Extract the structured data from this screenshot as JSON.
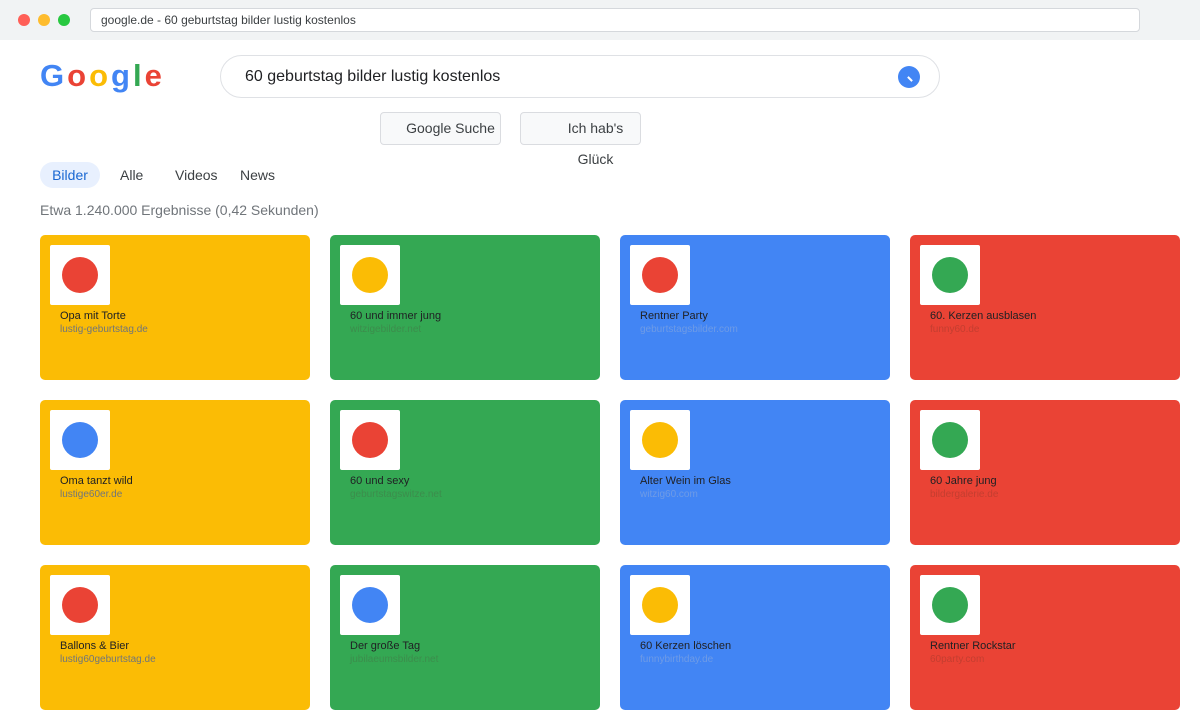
{
  "browser": {
    "address": "google.de - 60 geburtstag bilder lustig kostenlos"
  },
  "logo": {
    "letters": [
      {
        "ch": "G",
        "color": "#4285f4"
      },
      {
        "ch": "o",
        "color": "#ea4335"
      },
      {
        "ch": "o",
        "color": "#fbbc05"
      },
      {
        "ch": "g",
        "color": "#4285f4"
      },
      {
        "ch": "l",
        "color": "#34a853"
      },
      {
        "ch": "e",
        "color": "#ea4335"
      }
    ]
  },
  "search": {
    "query": "60 geburtstag bilder lustig kostenlos",
    "icon": "search-icon"
  },
  "buttons": {
    "search_label": "Google Suche",
    "lucky_label": "Ich hab's Glück"
  },
  "tabs": [
    {
      "label": "Bilder",
      "active": true
    },
    {
      "label": "Alle",
      "active": false
    },
    {
      "label": "Videos",
      "active": false
    },
    {
      "label": "News",
      "active": false
    }
  ],
  "stats": "Etwa 1.240.000 Ergebnisse (0,42 Sekunden)",
  "colors": {
    "yellow": "#fbbc05",
    "green": "#34a853",
    "blue": "#4285f4",
    "red": "#ea4335"
  },
  "results": [
    {
      "title": "Opa mit Torte",
      "source": "lustig-geburtstag.de",
      "card": "yellow",
      "dot": "red"
    },
    {
      "title": "60 und immer jung",
      "source": "witzigebilder.net",
      "card": "green",
      "dot": "yellow"
    },
    {
      "title": "Rentner Party",
      "source": "geburtstagsbilder.com",
      "card": "blue",
      "dot": "red"
    },
    {
      "title": "60. Kerzen ausblasen",
      "source": "funny60.de",
      "card": "red",
      "dot": "green"
    },
    {
      "title": "Oma tanzt wild",
      "source": "lustige60er.de",
      "card": "yellow",
      "dot": "blue"
    },
    {
      "title": "60 und sexy",
      "source": "geburtstagswitze.net",
      "card": "green",
      "dot": "red"
    },
    {
      "title": "Alter Wein im Glas",
      "source": "witzig60.com",
      "card": "blue",
      "dot": "yellow"
    },
    {
      "title": "60 Jahre jung",
      "source": "bildergalerie.de",
      "card": "red",
      "dot": "green"
    },
    {
      "title": "Ballons & Bier",
      "source": "lustig60geburtstag.de",
      "card": "yellow",
      "dot": "red"
    },
    {
      "title": "Der große Tag",
      "source": "jubilaeumsbilder.net",
      "card": "green",
      "dot": "blue"
    },
    {
      "title": "60 Kerzen löschen",
      "source": "funnybirthday.de",
      "card": "blue",
      "dot": "yellow"
    },
    {
      "title": "Rentner Rockstar",
      "source": "60party.com",
      "card": "red",
      "dot": "green"
    }
  ]
}
